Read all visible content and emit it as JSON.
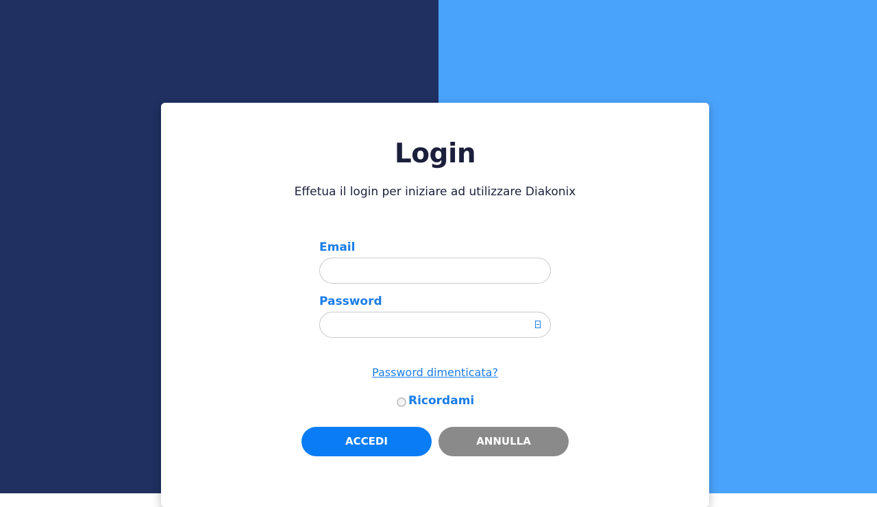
{
  "colors": {
    "background_left": "#1f3061",
    "background_right": "#4aa3fb",
    "accent": "#1a7de6",
    "primary_button": "#0a7cf5",
    "secondary_button": "#8a8a8a",
    "title_text": "#1b1f3b"
  },
  "login": {
    "title": "Login",
    "subtitle": "Effetua il login per iniziare ad utilizzare Diakonix",
    "email": {
      "label": "Email",
      "value": "",
      "placeholder": ""
    },
    "password": {
      "label": "Password",
      "value": "",
      "placeholder": "",
      "toggle_icon": "eye-icon"
    },
    "forgot_password": "Password dimenticata?",
    "remember_me": {
      "label": "Ricordami",
      "checked": false
    },
    "buttons": {
      "submit": "ACCEDI",
      "cancel": "ANNULLA"
    }
  }
}
